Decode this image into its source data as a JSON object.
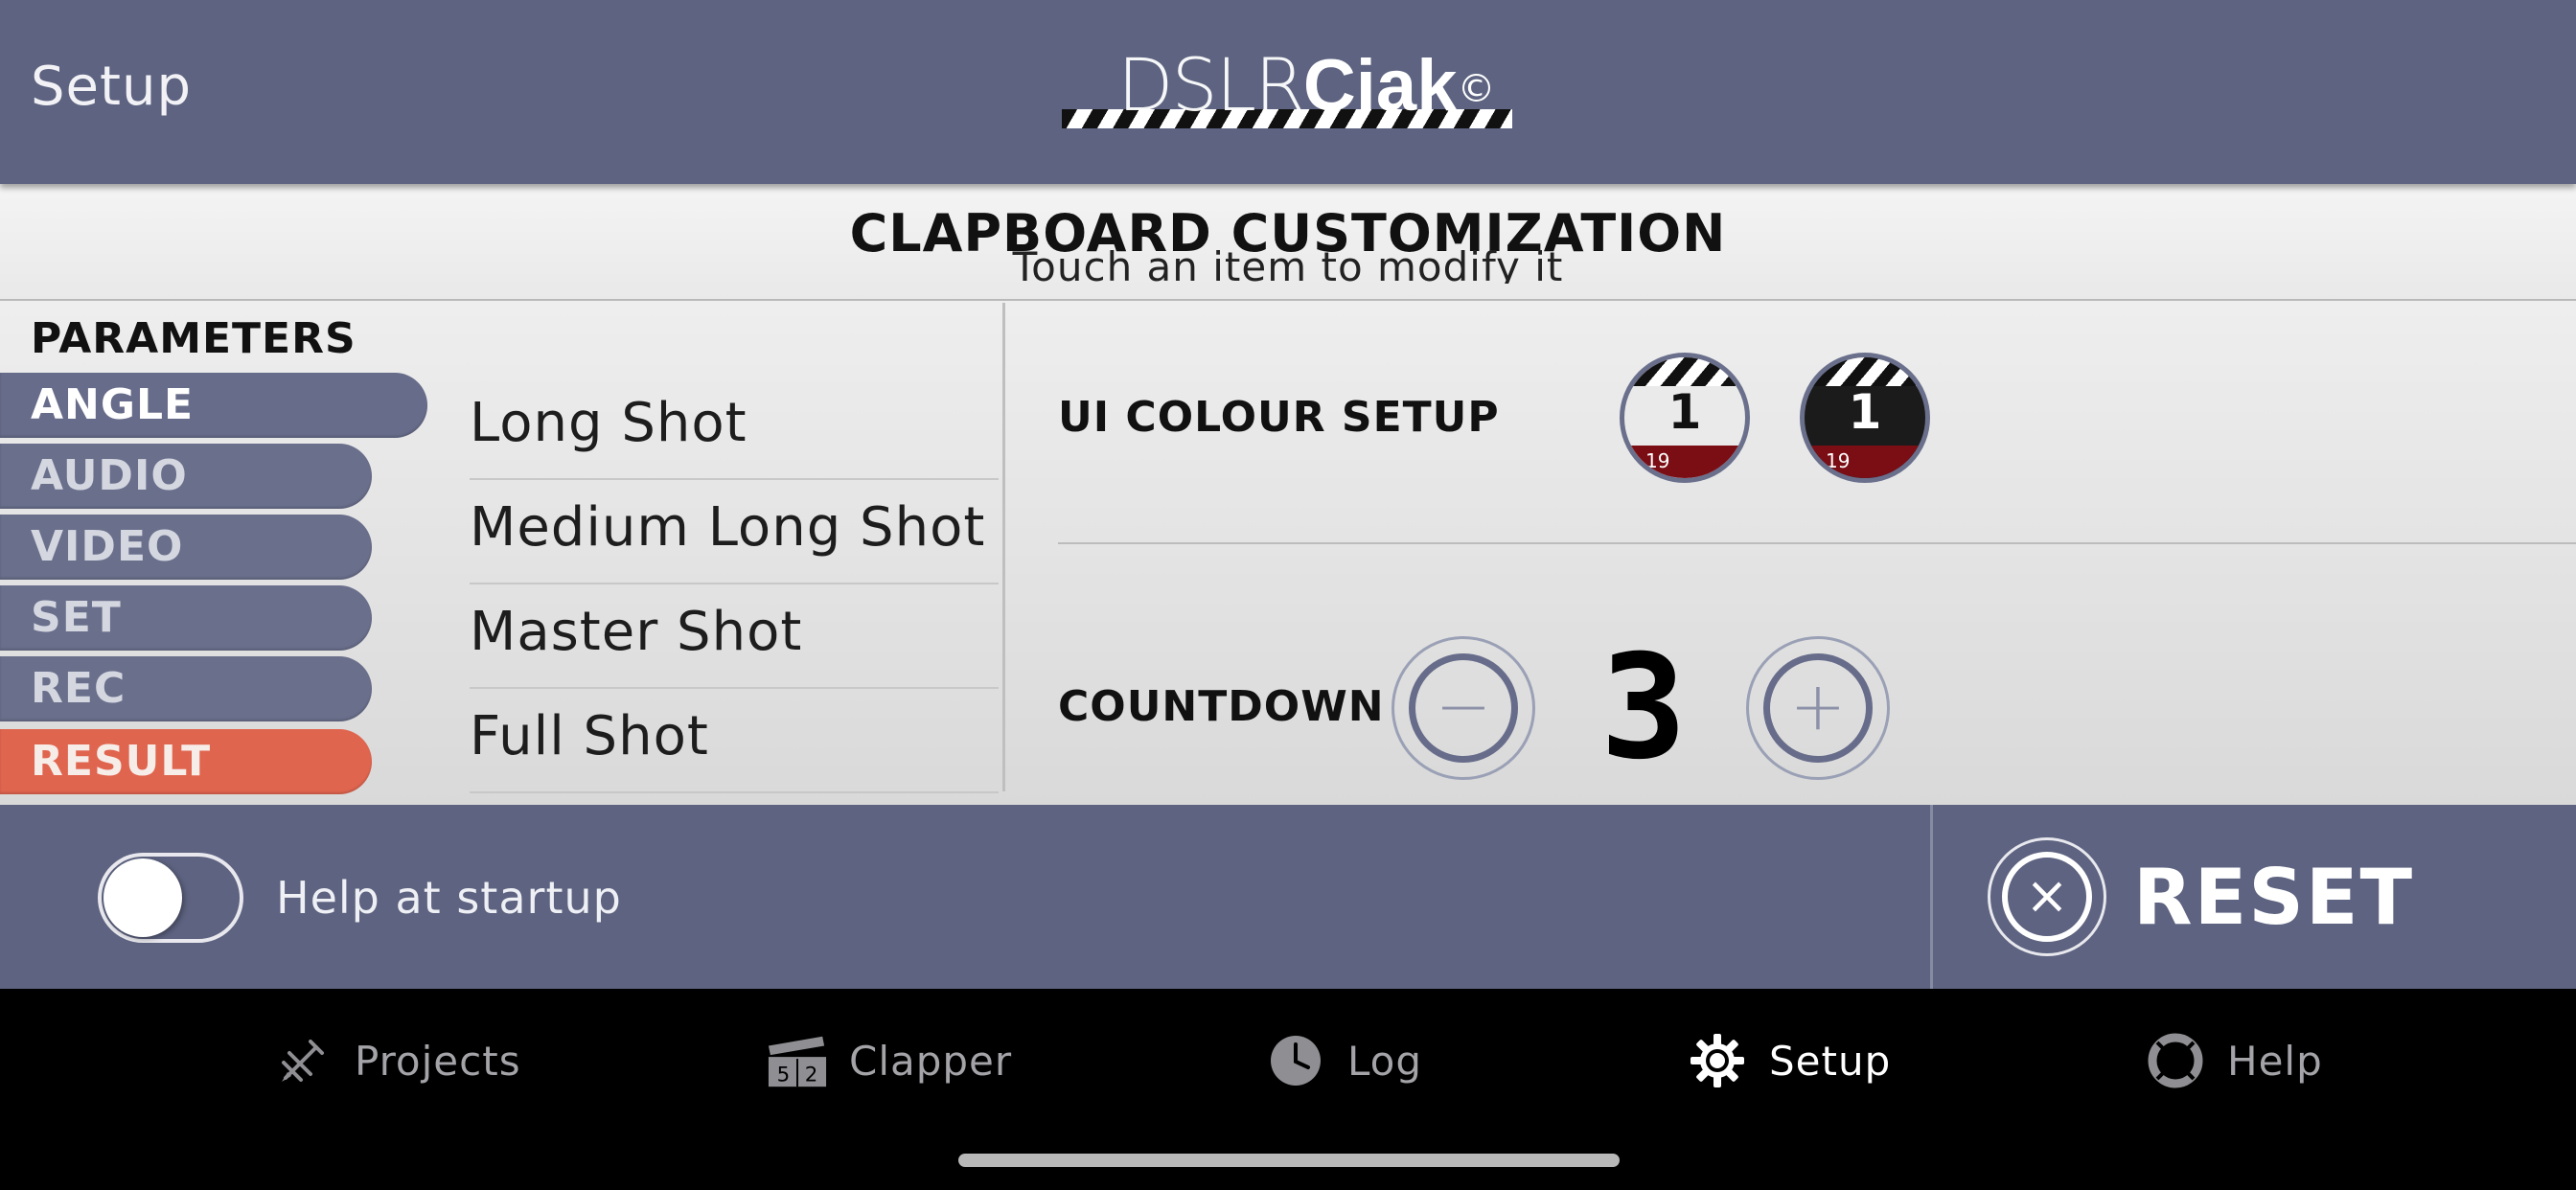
{
  "header": {
    "back_label": "Setup",
    "logo": {
      "thin": "DSLR",
      "bold": "Ciak",
      "mark": "©"
    }
  },
  "title_band": {
    "title": "CLAPBOARD CUSTOMIZATION",
    "subtitle": "Touch an item to modify it"
  },
  "parameters": {
    "label": "PARAMETERS",
    "tabs": [
      {
        "label": "ANGLE",
        "state": "active"
      },
      {
        "label": "AUDIO",
        "state": "normal"
      },
      {
        "label": "VIDEO",
        "state": "normal"
      },
      {
        "label": "SET",
        "state": "normal"
      },
      {
        "label": "REC",
        "state": "normal"
      },
      {
        "label": "RESULT",
        "state": "highlight"
      }
    ],
    "options": [
      "Long Shot",
      "Medium Long Shot",
      "Master Shot",
      "Full Shot"
    ]
  },
  "ui_colour": {
    "label": "UI COLOUR SETUP",
    "options": [
      {
        "name": "light",
        "number": "1",
        "scene": "19"
      },
      {
        "name": "dark",
        "number": "1",
        "scene": "19"
      }
    ]
  },
  "countdown": {
    "label": "COUNTDOWN",
    "value": "3",
    "minus_glyph": "−",
    "plus_glyph": "+"
  },
  "bottom": {
    "help_label": "Help at startup",
    "help_enabled": false,
    "reset_label": "RESET"
  },
  "tabbar": {
    "items": [
      {
        "label": "Projects",
        "icon": "pen-icon",
        "active": false
      },
      {
        "label": "Clapper",
        "icon": "clapper-icon",
        "active": false
      },
      {
        "label": "Log",
        "icon": "clock-icon",
        "active": false
      },
      {
        "label": "Setup",
        "icon": "gear-icon",
        "active": true
      },
      {
        "label": "Help",
        "icon": "lifebuoy-icon",
        "active": false
      }
    ]
  },
  "colors": {
    "header_bg": "#5d6380",
    "tab_bg": "#6a6f8c",
    "result_bg": "#e0654f",
    "tabbar_bg": "#000000"
  }
}
